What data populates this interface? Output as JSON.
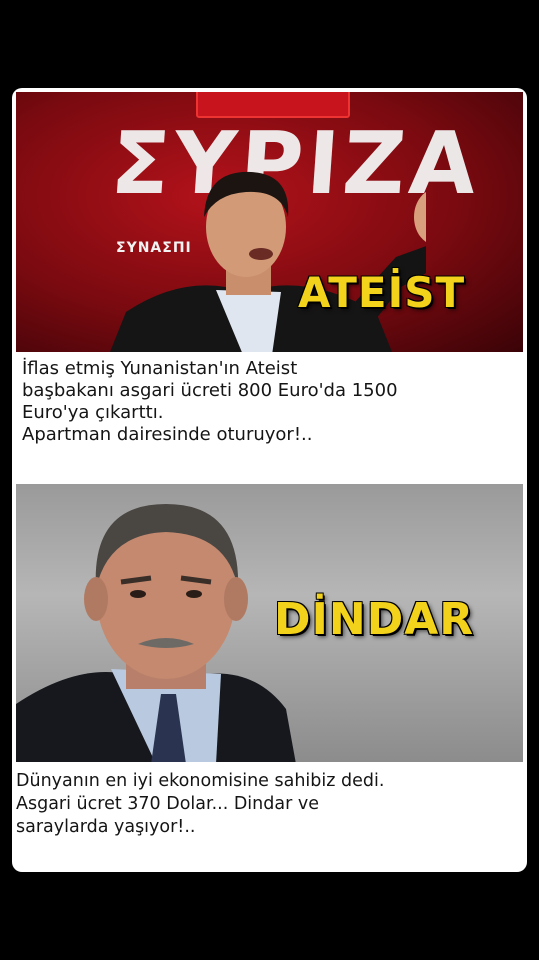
{
  "image": {
    "top_panel": {
      "sign_text": "ΣΥΡΙΖΑ",
      "sign_subtext": "ΣΥΝΑΣΠΙ",
      "label": "ATEİST",
      "caption_lines": [
        "İflas etmiş Yunanistan'ın Ateist",
        "başbakanı asgari ücreti 800 Euro'da 1500",
        "Euro'ya çıkarttı.",
        "Apartman dairesinde oturuyor!.."
      ]
    },
    "bottom_panel": {
      "label": "DİNDAR",
      "caption_lines": [
        "Dünyanın en iyi ekonomisine sahibiz dedi.",
        "Asgari ücret 370 Dolar... Dindar ve",
        "saraylarda yaşıyor!.."
      ]
    },
    "colors": {
      "label_yellow": "#f2d21a",
      "banner_red": "#b4121a",
      "background": "#000000"
    }
  }
}
